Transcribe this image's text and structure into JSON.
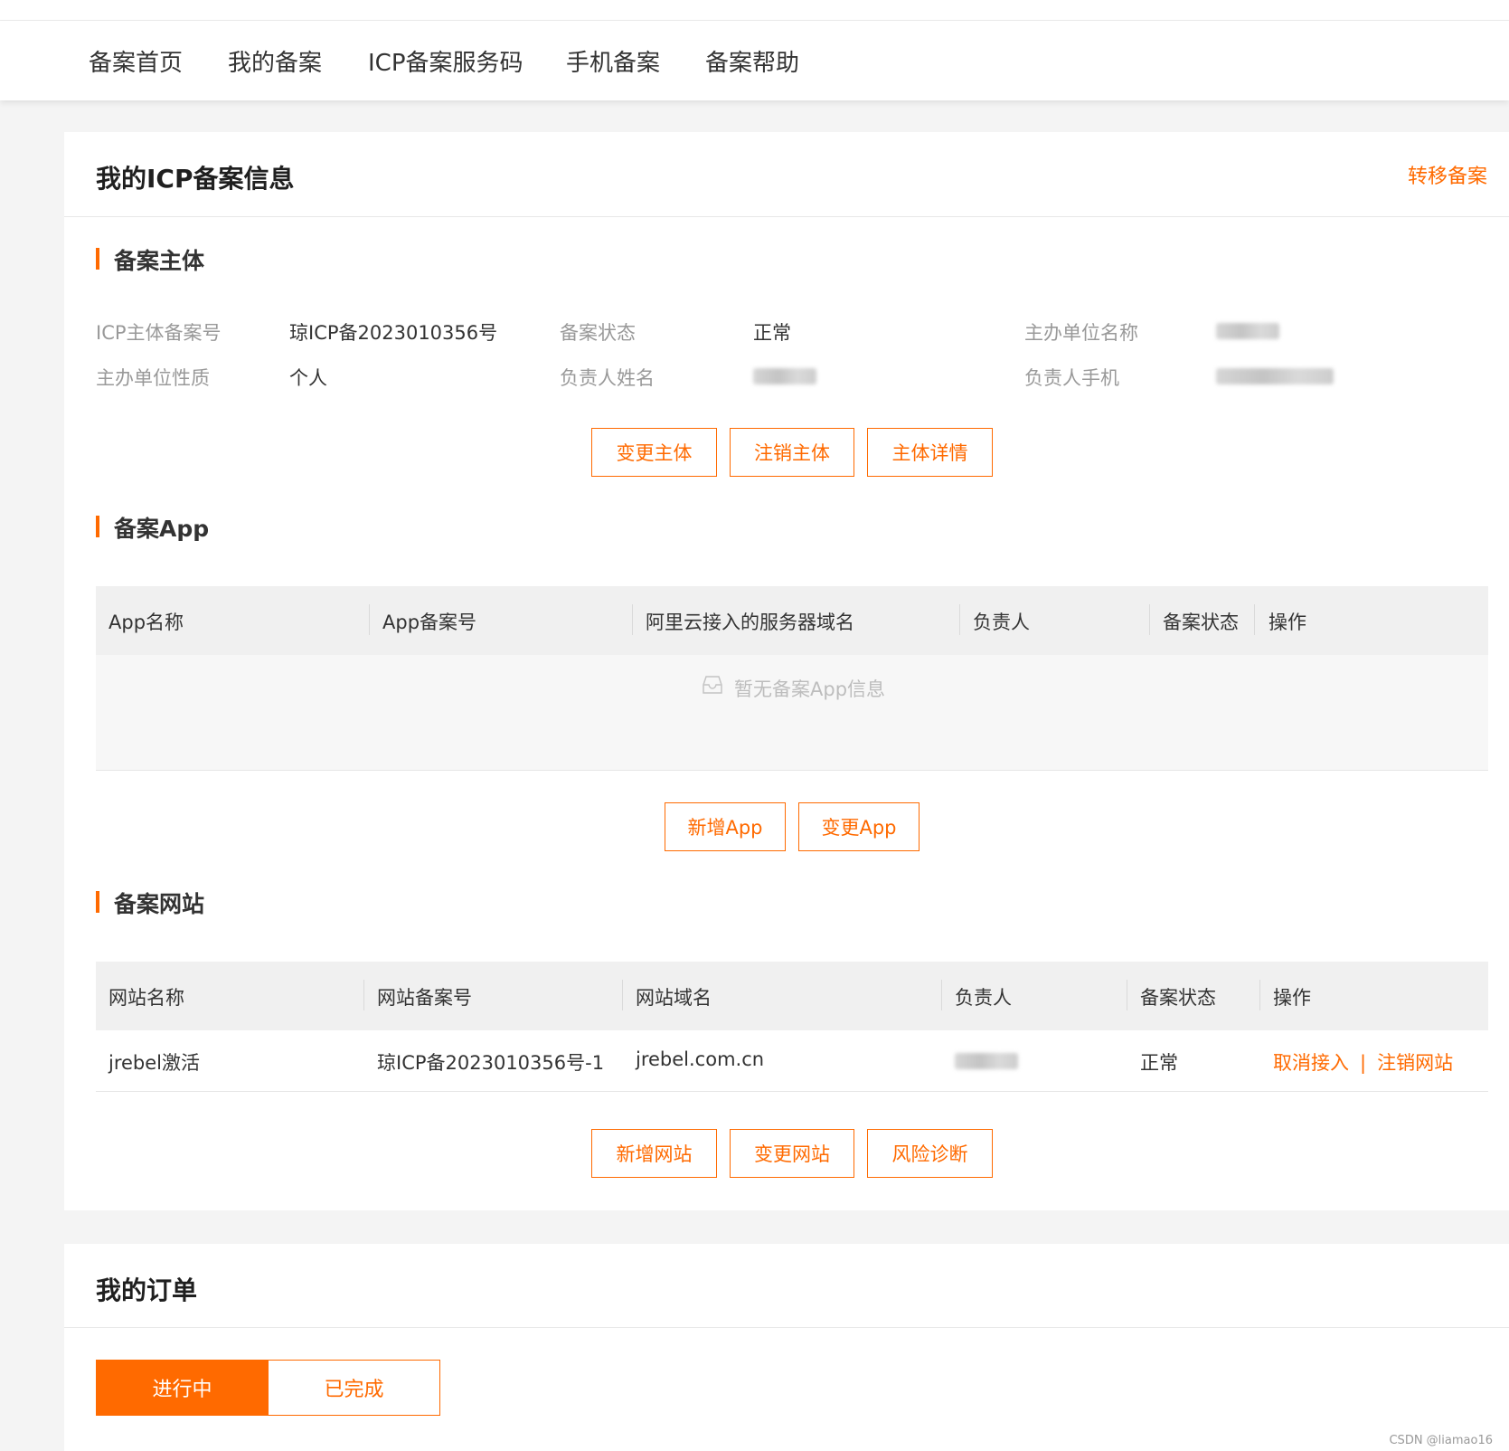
{
  "nav": {
    "items": [
      {
        "label": "备案首页"
      },
      {
        "label": "我的备案"
      },
      {
        "label": "ICP备案服务码"
      },
      {
        "label": "手机备案"
      },
      {
        "label": "备案帮助"
      }
    ]
  },
  "icp_card": {
    "title": "我的ICP备案信息",
    "transfer_link": "转移备案",
    "subject": {
      "section_title": "备案主体",
      "fields": [
        {
          "label": "ICP主体备案号",
          "value": "琼ICP备2023010356号"
        },
        {
          "label": "备案状态",
          "value": "正常"
        },
        {
          "label": "主办单位名称",
          "value": ""
        },
        {
          "label": "主办单位性质",
          "value": "个人"
        },
        {
          "label": "负责人姓名",
          "value": ""
        },
        {
          "label": "负责人手机",
          "value": ""
        }
      ],
      "buttons": [
        "变更主体",
        "注销主体",
        "主体详情"
      ]
    },
    "app": {
      "section_title": "备案App",
      "columns": [
        "App名称",
        "App备案号",
        "阿里云接入的服务器域名",
        "负责人",
        "备案状态",
        "操作"
      ],
      "empty_text": "暂无备案App信息",
      "empty_icon": "empty-inbox-icon",
      "buttons": [
        "新增App",
        "变更App"
      ]
    },
    "website": {
      "section_title": "备案网站",
      "columns": [
        "网站名称",
        "网站备案号",
        "网站域名",
        "负责人",
        "备案状态",
        "操作"
      ],
      "rows": [
        {
          "name": "jrebel激活",
          "record_no": "琼ICP备2023010356号-1",
          "domain": "jrebel.com.cn",
          "owner": "",
          "status": "正常",
          "actions": [
            "取消接入",
            "注销网站"
          ]
        }
      ],
      "buttons": [
        "新增网站",
        "变更网站",
        "风险诊断"
      ]
    }
  },
  "orders_card": {
    "title": "我的订单",
    "tabs": [
      {
        "label": "进行中",
        "active": true
      },
      {
        "label": "已完成",
        "active": false
      }
    ]
  },
  "watermark": "CSDN @liamao16",
  "colors": {
    "accent": "#ff6a00",
    "page_bg": "#f4f4f4",
    "table_header_bg": "#f0f0f0"
  }
}
